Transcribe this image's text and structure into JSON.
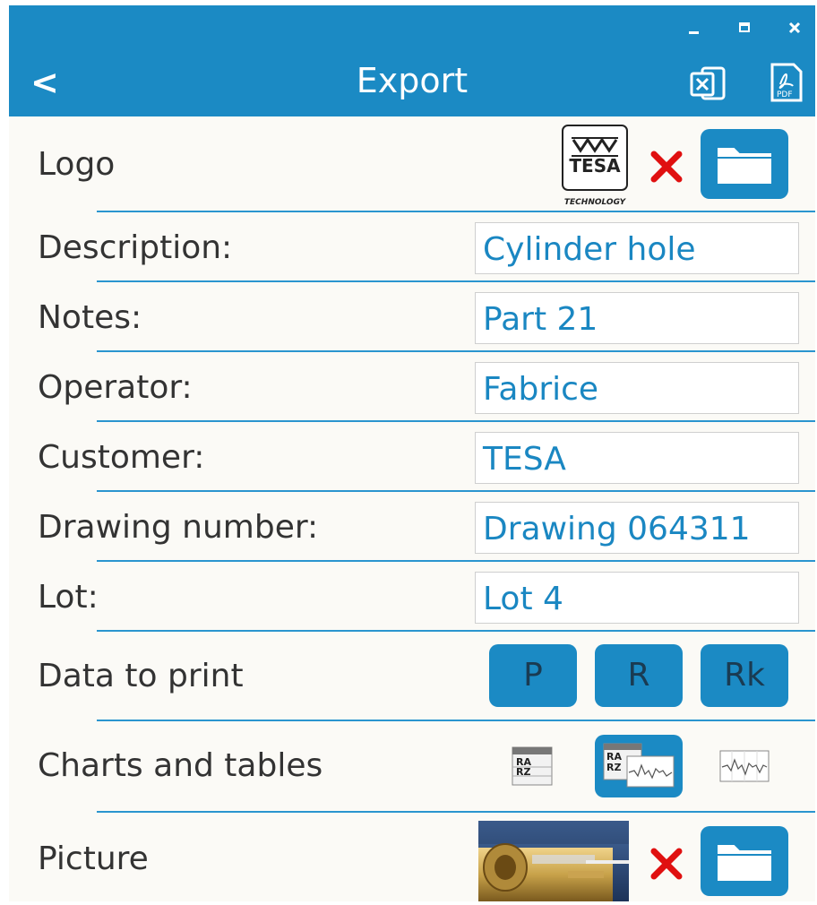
{
  "window": {
    "title": "Export",
    "controls": [
      "minimize-icon",
      "maximize-icon",
      "close-icon"
    ],
    "back_label": "<"
  },
  "header": {
    "excel_icon": "excel-export-icon",
    "pdf_icon": "pdf-export-icon",
    "pdf_text": "PDF"
  },
  "logo_row": {
    "label": "Logo",
    "logo_text": "TESA",
    "logo_subtext": "TECHNOLOGY"
  },
  "fields": [
    {
      "label": "Description:",
      "value": "Cylinder hole"
    },
    {
      "label": "Notes:",
      "value": "Part 21"
    },
    {
      "label": "Operator:",
      "value": "Fabrice"
    },
    {
      "label": "Customer:",
      "value": "TESA"
    },
    {
      "label": "Drawing number:",
      "value": "Drawing 064311"
    },
    {
      "label": "Lot:",
      "value": "Lot 4"
    }
  ],
  "data_to_print": {
    "label": "Data to print",
    "buttons": [
      "P",
      "R",
      "Rk"
    ]
  },
  "charts_tables": {
    "label": "Charts and tables",
    "table_text_1": "RA",
    "table_text_2": "RZ",
    "selected": "table-and-chart"
  },
  "picture_row": {
    "label": "Picture"
  },
  "colors": {
    "accent": "#1b8ac4",
    "background": "#fbfaf6",
    "value_text": "#1a87c2",
    "remove": "#e01010"
  }
}
